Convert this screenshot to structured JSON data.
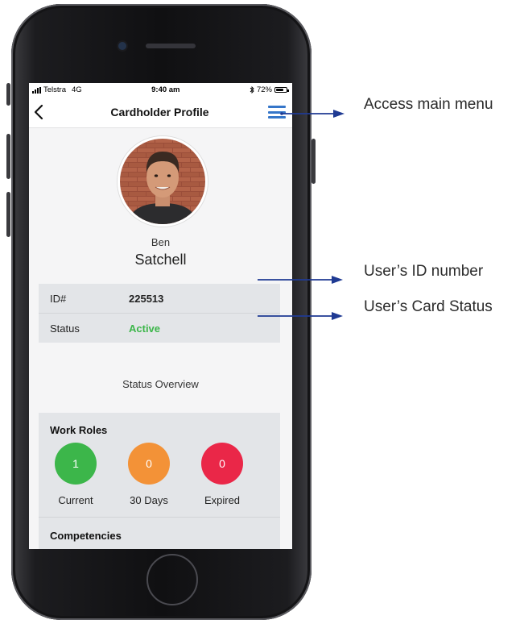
{
  "status_bar": {
    "carrier": "Telstra",
    "network": "4G",
    "time": "9:40 am",
    "bluetooth_icon": "bluetooth-icon",
    "battery_percent": "72%",
    "battery_level": 0.72
  },
  "nav": {
    "title": "Cardholder Profile",
    "back_icon": "chevron-left-icon",
    "menu_icon": "hamburger-menu-icon"
  },
  "profile": {
    "first_name": "Ben",
    "last_name": "Satchell",
    "id_label": "ID#",
    "id_value": "225513",
    "status_label": "Status",
    "status_value": "Active"
  },
  "status_overview": "Status Overview",
  "work_roles": {
    "title": "Work Roles",
    "items": [
      {
        "count": "1",
        "label": "Current",
        "color": "#3cb64a"
      },
      {
        "count": "0",
        "label": "30 Days",
        "color": "#f39237"
      },
      {
        "count": "0",
        "label": "Expired",
        "color": "#ea2748"
      }
    ]
  },
  "competencies_title": "Competencies",
  "callouts": {
    "menu": "Access main menu",
    "id": "User’s ID number",
    "status": "User’s Card Status"
  },
  "colors": {
    "accent": "#3576c9",
    "active": "#3cb64a",
    "arrow": "#1f3a93"
  }
}
